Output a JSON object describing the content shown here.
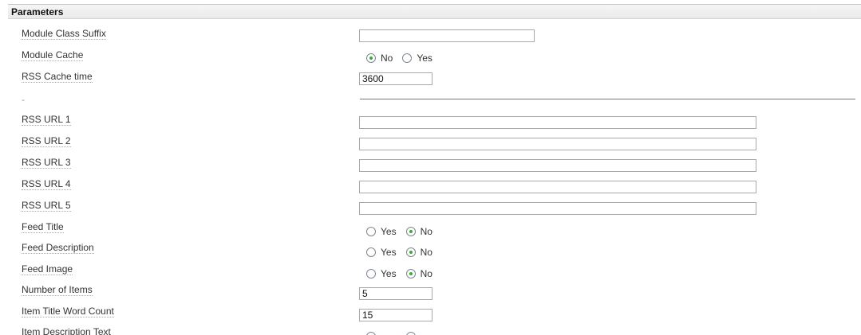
{
  "header": {
    "title": "Parameters"
  },
  "fields": {
    "module_class_suffix": {
      "label": "Module Class Suffix",
      "value": ""
    },
    "module_cache": {
      "label": "Module Cache",
      "options": [
        "No",
        "Yes"
      ],
      "selected": "No"
    },
    "rss_cache_time": {
      "label": "RSS Cache time",
      "value": "3600"
    },
    "separator_label": "-",
    "rss_url_1": {
      "label": "RSS URL 1",
      "value": ""
    },
    "rss_url_2": {
      "label": "RSS URL 2",
      "value": ""
    },
    "rss_url_3": {
      "label": "RSS URL 3",
      "value": ""
    },
    "rss_url_4": {
      "label": "RSS URL 4",
      "value": ""
    },
    "rss_url_5": {
      "label": "RSS URL 5",
      "value": ""
    },
    "feed_title": {
      "label": "Feed Title",
      "options": [
        "Yes",
        "No"
      ],
      "selected": "No"
    },
    "feed_description": {
      "label": "Feed Description",
      "options": [
        "Yes",
        "No"
      ],
      "selected": "No"
    },
    "feed_image": {
      "label": "Feed Image",
      "options": [
        "Yes",
        "No"
      ],
      "selected": "No"
    },
    "number_of_items": {
      "label": "Number of Items",
      "value": "5"
    },
    "item_title_word_count": {
      "label": "Item Title Word Count",
      "value": "15"
    },
    "item_description_text": {
      "label": "Item Description Text"
    }
  },
  "colors": {
    "radio_selected": "#2fb12f",
    "header_bg": "#ececec"
  }
}
